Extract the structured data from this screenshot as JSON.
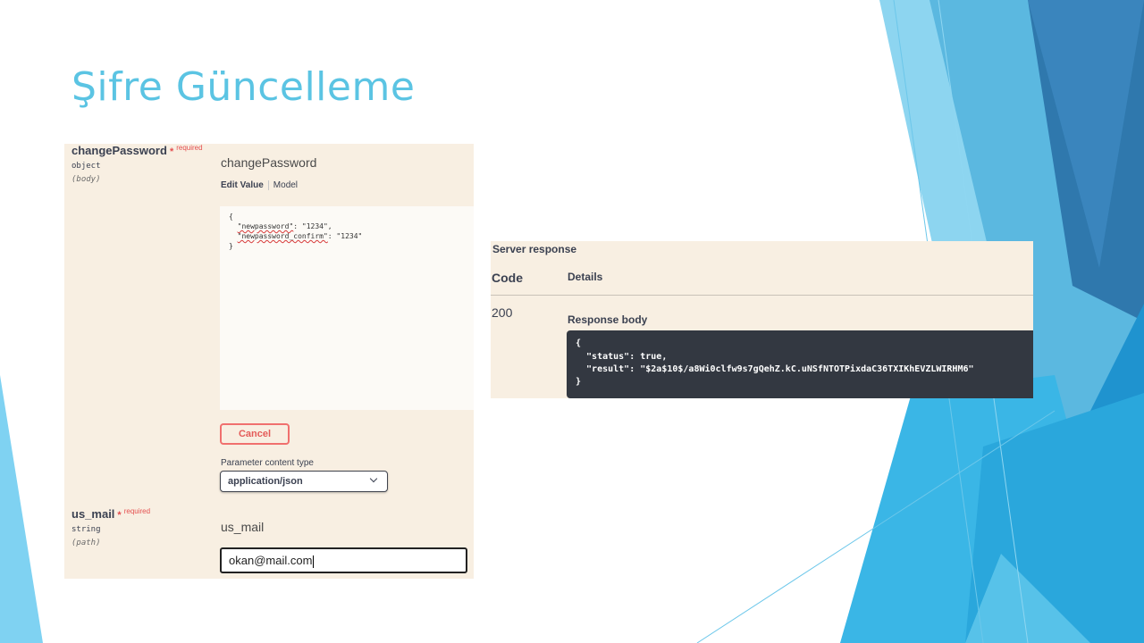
{
  "slide": {
    "title": "Şifre Güncelleme"
  },
  "params": [
    {
      "name": "changePassword",
      "required_star": "*",
      "required_text": "required",
      "type": "object",
      "in": "(body)"
    },
    {
      "name": "us_mail",
      "required_star": "*",
      "required_text": "required",
      "type": "string",
      "in": "(path)"
    }
  ],
  "body_field": {
    "heading": "changePassword",
    "tabs": [
      "Edit Value",
      "Model"
    ],
    "editor": {
      "open": "{",
      "line1_key": "\"newpassword\"",
      "line1_rest": ": \"1234\",",
      "line2_key": "\"newpassword_confirm\"",
      "line2_rest": ": \"1234\"",
      "close": "}"
    },
    "cancel_label": "Cancel",
    "content_type_label": "Parameter content type",
    "content_type_value": "application/json"
  },
  "mail_field": {
    "heading": "us_mail",
    "value": "okan@mail.com"
  },
  "server_response": {
    "title": "Server response",
    "col_code": "Code",
    "col_details": "Details",
    "code": "200",
    "body_label": "Response body",
    "body_lines": [
      "{",
      "  \"status\": true,",
      "  \"result\": \"$2a$10$/a8Wi0clfw9s7gQehZ.kC.uNSfNTOTPixdaC36TXIKhEVZLWIRHM6\"",
      "}"
    ]
  },
  "colors": {
    "title": "#5bc4e3",
    "panel_bg": "#f8efe2",
    "cancel": "#f0706e",
    "response_bg": "#333841"
  }
}
